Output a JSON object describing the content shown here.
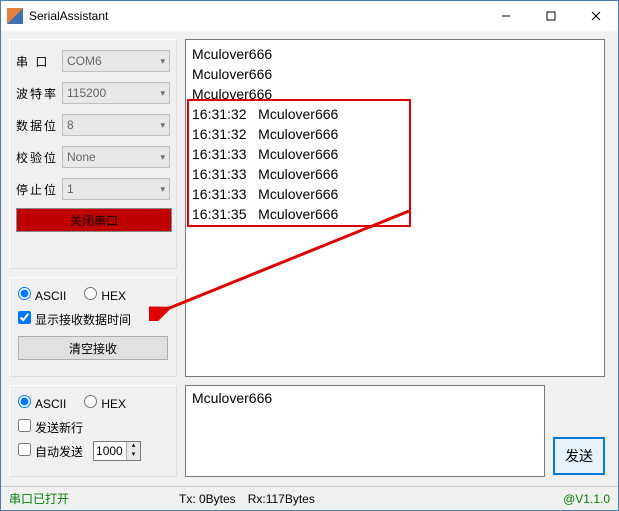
{
  "window": {
    "title": "SerialAssistant"
  },
  "config": {
    "port_label": "串 口",
    "port_value": "COM6",
    "baud_label": "波特率",
    "baud_value": "115200",
    "databits_label": "数据位",
    "databits_value": "8",
    "parity_label": "校验位",
    "parity_value": "None",
    "stopbits_label": "停止位",
    "stopbits_value": "1",
    "close_btn": "关闭串口"
  },
  "rxopt": {
    "ascii": "ASCII",
    "hex": "HEX",
    "show_time": "显示接收数据时间",
    "clear_btn": "清空接收"
  },
  "txopt": {
    "ascii": "ASCII",
    "hex": "HEX",
    "newline": "发送新行",
    "autosend": "自动发送",
    "interval": "1000"
  },
  "rx": {
    "plain": [
      "Mculover666",
      "Mculover666",
      "Mculover666"
    ],
    "timed": [
      {
        "t": "16:31:32",
        "m": "Mculover666"
      },
      {
        "t": "16:31:32",
        "m": "Mculover666"
      },
      {
        "t": "16:31:33",
        "m": "Mculover666"
      },
      {
        "t": "16:31:33",
        "m": "Mculover666"
      },
      {
        "t": "16:31:33",
        "m": "Mculover666"
      },
      {
        "t": "16:31:35",
        "m": "Mculover666"
      }
    ]
  },
  "tx": {
    "text": "Mculover666",
    "send_btn": "发送"
  },
  "status": {
    "open": "串口已打开",
    "tx": "Tx: 0Bytes",
    "rx": "Rx:117Bytes",
    "version": "@V1.1.0"
  }
}
